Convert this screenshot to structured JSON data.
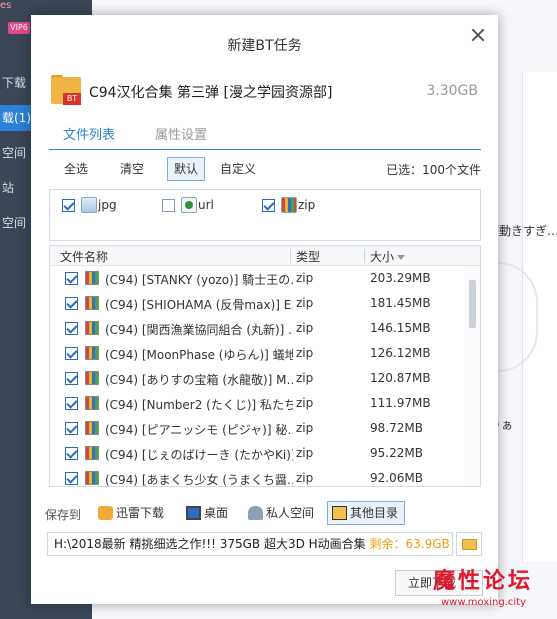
{
  "background": {
    "sidebar": {
      "top_text": "es",
      "vip_badge": "VIP6",
      "items": [
        "下载",
        "载(1)",
        "空间",
        "站",
        "空间"
      ]
    },
    "main": {
      "right_texts": [
        "が動きすぎ…",
        "りぁ"
      ]
    }
  },
  "dialog": {
    "title": "新建BT任务",
    "close_icon": "close-icon",
    "task": {
      "name": "C94汉化合集 第三弹 [漫之学园资源部]",
      "size": "3.30GB",
      "badge": "BT",
      "icon": "folder-bt-icon"
    },
    "tabs": [
      {
        "label": "文件列表",
        "active": true
      },
      {
        "label": "属性设置",
        "active": false
      }
    ],
    "filter": {
      "select_all": "全选",
      "clear": "清空",
      "default": "默认",
      "custom": "自定义",
      "selected_count": "已选：100个文件",
      "active_filter": "默认"
    },
    "file_types": [
      {
        "label": "jpg",
        "checked": true,
        "icon": "jpg-icon"
      },
      {
        "label": "url",
        "checked": false,
        "icon": "url-icon"
      },
      {
        "label": "zip",
        "checked": true,
        "icon": "zip-icon"
      }
    ],
    "table": {
      "headers": {
        "name": "文件名称",
        "type": "类型",
        "size": "大小"
      },
      "rows": [
        {
          "name": "(C94) [STANKY (yozo)] 騎士王の…",
          "type": "zip",
          "size": "203.29MB",
          "checked": true
        },
        {
          "name": "(C94) [SHIOHAMA (反骨max)] E…",
          "type": "zip",
          "size": "181.45MB",
          "checked": true
        },
        {
          "name": "(C94) [関西漁業協同組合 (丸新)] …",
          "type": "zip",
          "size": "146.15MB",
          "checked": true
        },
        {
          "name": "(C94) [MoonPhase (ゆらん)] 蟻地…",
          "type": "zip",
          "size": "126.12MB",
          "checked": true
        },
        {
          "name": "(C94) [ありすの宝箱 (水龍敬)] M…",
          "type": "zip",
          "size": "120.87MB",
          "checked": true
        },
        {
          "name": "(C94) [Number2 (たくじ)] 私たち…",
          "type": "zip",
          "size": "111.97MB",
          "checked": true
        },
        {
          "name": "(C94) [ピアニッシモ (ピジャ)] 秘…",
          "type": "zip",
          "size": "98.72MB",
          "checked": true
        },
        {
          "name": "(C94) [じぇのばけーき (たかやKi)]…",
          "type": "zip",
          "size": "95.22MB",
          "checked": true
        },
        {
          "name": "(C94) [あまくち少女 (うまくち醤…",
          "type": "zip",
          "size": "92.06MB",
          "checked": true
        }
      ]
    },
    "save": {
      "label": "保存到",
      "locations": [
        {
          "label": "迅雷下载",
          "icon": "thunder-folder-icon",
          "selected": false
        },
        {
          "label": "桌面",
          "icon": "desktop-icon",
          "selected": false
        },
        {
          "label": "私人空间",
          "icon": "private-cloud-icon",
          "selected": false
        },
        {
          "label": "其他目录",
          "icon": "other-folder-icon",
          "selected": true
        }
      ],
      "path": "H:\\2018最新 精挑细选之作!!! 375GB  超大3D H动画合集",
      "free_label": "剩余：",
      "free_value": "63.9GB"
    },
    "start_button": "立即下载"
  },
  "watermark": {
    "title": "魔性论坛",
    "url": "www.moxing.city"
  }
}
